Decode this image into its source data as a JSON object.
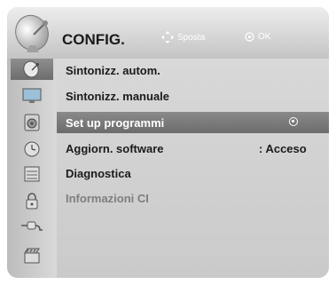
{
  "header": {
    "title": "CONFIG.",
    "hint_move": "Sposta",
    "hint_ok": "OK"
  },
  "sidebar": {
    "icons": [
      {
        "name": "setup-satellite-icon",
        "active": true
      },
      {
        "name": "picture-icon",
        "active": false
      },
      {
        "name": "audio-icon",
        "active": false
      },
      {
        "name": "time-icon",
        "active": false
      },
      {
        "name": "option-icon",
        "active": false
      },
      {
        "name": "lock-icon",
        "active": false
      },
      {
        "name": "input-icon",
        "active": false
      },
      {
        "name": "usb-media-icon",
        "active": false
      }
    ]
  },
  "menu": {
    "items": [
      {
        "label": "Sintonizz. autom."
      },
      {
        "label": "Sintonizz. manuale"
      },
      {
        "label": "Set up programmi"
      },
      {
        "label": "Aggiorn. software",
        "value": ": Acceso"
      },
      {
        "label": "Diagnostica"
      },
      {
        "label": "Informazioni CI"
      }
    ],
    "selected_index": 2
  },
  "colors": {
    "selected_bg": "#7a7a7a",
    "panel_bg": "#cfcfcf",
    "disabled_text": "#7e7e7e"
  }
}
